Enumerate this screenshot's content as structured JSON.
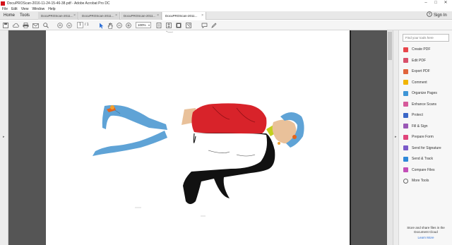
{
  "window": {
    "title": "DocuPROScan-2016-11-24-15-46-38.pdf - Adobe Acrobat Pro DC",
    "minimize": "–",
    "maximize": "□",
    "close": "✕"
  },
  "menu": {
    "items": [
      "File",
      "Edit",
      "View",
      "Window",
      "Help"
    ]
  },
  "tabs": {
    "home": "Home",
    "tools": "Tools",
    "documents": [
      {
        "label": "DocuPROScan-2011...",
        "active": false
      },
      {
        "label": "DocuPROScan-2011...",
        "active": false
      },
      {
        "label": "DocuPROScan-2011...",
        "active": false
      },
      {
        "label": "DocuPROScan-2011...",
        "active": true
      }
    ],
    "close_glyph": "×",
    "help_icon": "?",
    "sign_in": "Sign In"
  },
  "toolbar": {
    "page_current": "1",
    "page_total": "/ 1",
    "zoom": "100%",
    "zoom_caret": "▾"
  },
  "nav": {
    "left_arrow": "◂",
    "right_arrow": "▸"
  },
  "right_pane": {
    "search_placeholder": "Find your tools here",
    "tools": [
      {
        "label": "Create PDF",
        "color": "#e8454a"
      },
      {
        "label": "Edit PDF",
        "color": "#d8506a"
      },
      {
        "label": "Export PDF",
        "color": "#e0643c"
      },
      {
        "label": "Comment",
        "color": "#f0b400"
      },
      {
        "label": "Organize Pages",
        "color": "#3f95d6"
      },
      {
        "label": "Enhance Scans",
        "color": "#d65a9b"
      },
      {
        "label": "Protect",
        "color": "#3b67c7"
      },
      {
        "label": "Fill & Sign",
        "color": "#9b59b6"
      },
      {
        "label": "Prepare Form",
        "color": "#e0457b"
      },
      {
        "label": "Send for Signature",
        "color": "#7b5bc9"
      },
      {
        "label": "Send & Track",
        "color": "#2f89d9"
      },
      {
        "label": "Compare Files",
        "color": "#c44fb8"
      },
      {
        "label": "More Tools",
        "color": "#666666"
      }
    ],
    "cloud_text": "Store and share files in the Document Cloud",
    "learn_more": "Learn More"
  },
  "colors": {
    "accent": "#2d6fd6",
    "doc_background": "#555555",
    "drawing_red": "#d8232a",
    "drawing_black": "#111111",
    "drawing_blue": "#5fa3d6"
  }
}
